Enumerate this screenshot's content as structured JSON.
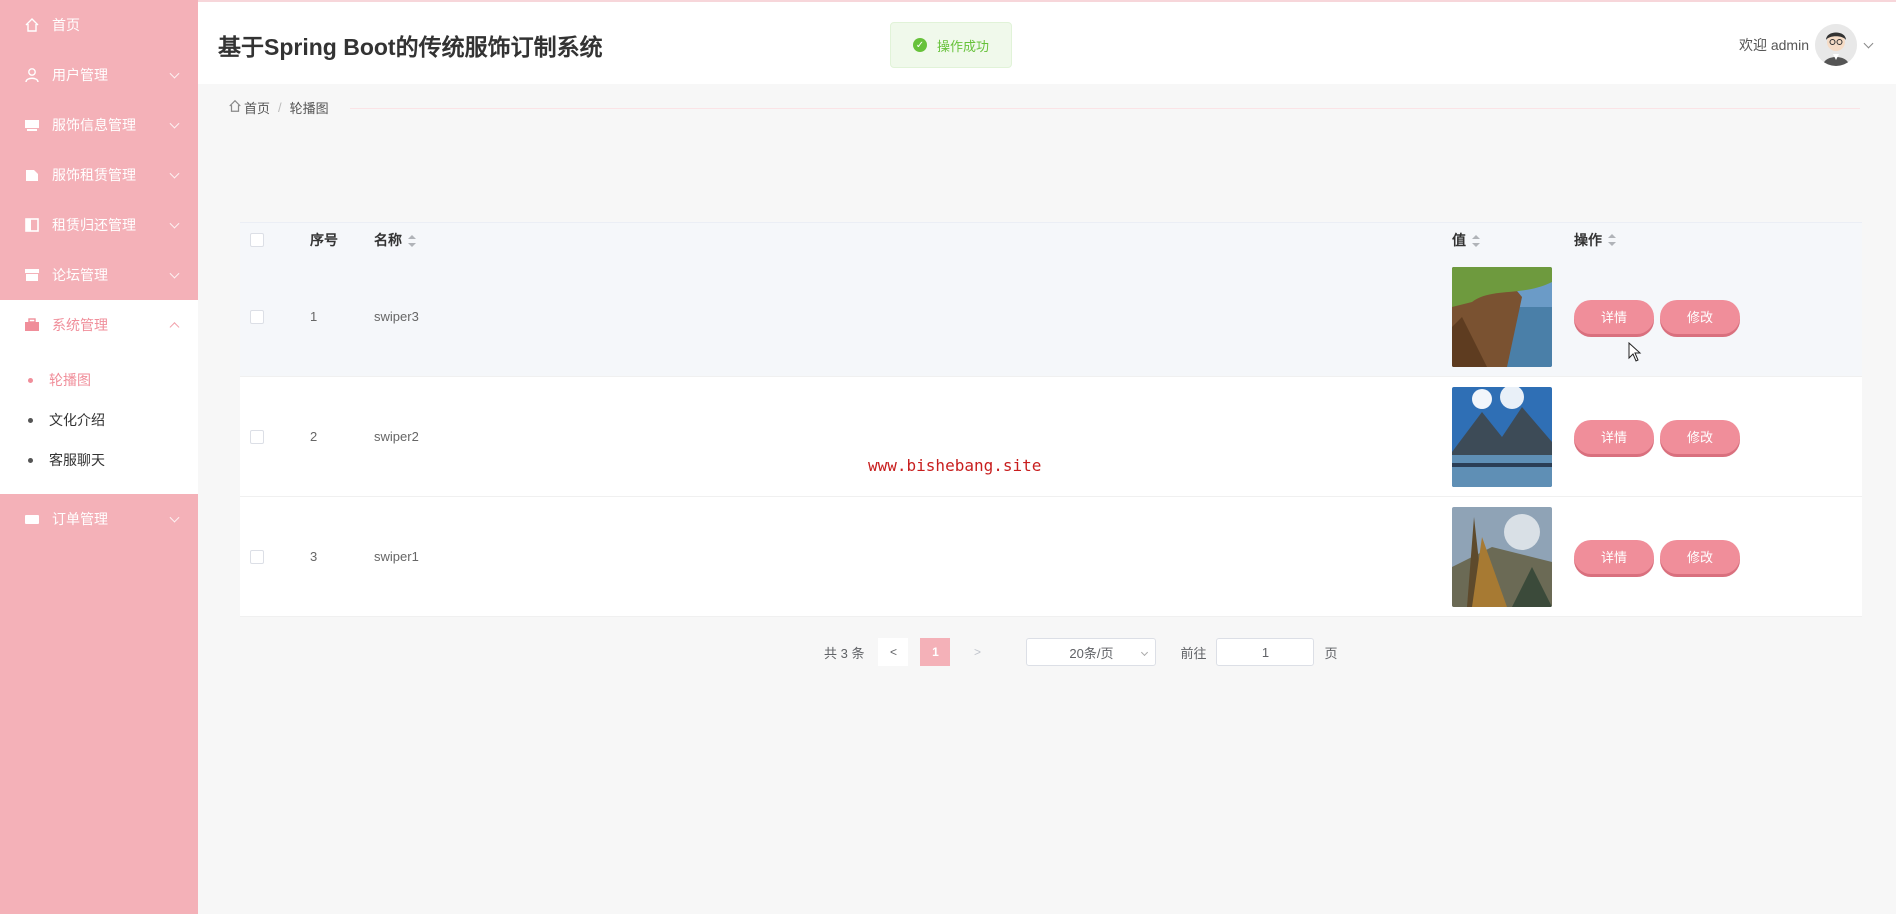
{
  "sidebar": {
    "items": [
      {
        "label": "首页",
        "icon": "home-icon"
      },
      {
        "label": "用户管理",
        "icon": "user-icon"
      },
      {
        "label": "服饰信息管理",
        "icon": "monitor-icon"
      },
      {
        "label": "服饰租赁管理",
        "icon": "document-icon"
      },
      {
        "label": "租赁归还管理",
        "icon": "book-icon"
      },
      {
        "label": "论坛管理",
        "icon": "box-icon"
      },
      {
        "label": "系统管理",
        "icon": "briefcase-icon"
      },
      {
        "label": "订单管理",
        "icon": "cart-icon"
      }
    ],
    "submenu": [
      {
        "label": "轮播图"
      },
      {
        "label": "文化介绍"
      },
      {
        "label": "客服聊天"
      }
    ]
  },
  "header": {
    "title": "基于Spring Boot的传统服饰订制系统",
    "toast": "操作成功",
    "welcome": "欢迎 admin"
  },
  "breadcrumb": {
    "home": "首页",
    "current": "轮播图"
  },
  "table": {
    "columns": {
      "index": "序号",
      "name": "名称",
      "value": "值",
      "action": "操作"
    },
    "rows": [
      {
        "index": "1",
        "name": "swiper3"
      },
      {
        "index": "2",
        "name": "swiper2"
      },
      {
        "index": "3",
        "name": "swiper1"
      }
    ],
    "detail_label": "详情",
    "edit_label": "修改"
  },
  "pagination": {
    "total": "共 3 条",
    "prev": "<",
    "current": "1",
    "next": ">",
    "page_size": "20条/页",
    "goto_label": "前往",
    "goto_value": "1",
    "page_suffix": "页"
  },
  "watermark": "www.bishebang.site",
  "colors": {
    "sidebar": "#f4b1b8",
    "accent": "#f08e9a",
    "success": "#67c23a"
  }
}
